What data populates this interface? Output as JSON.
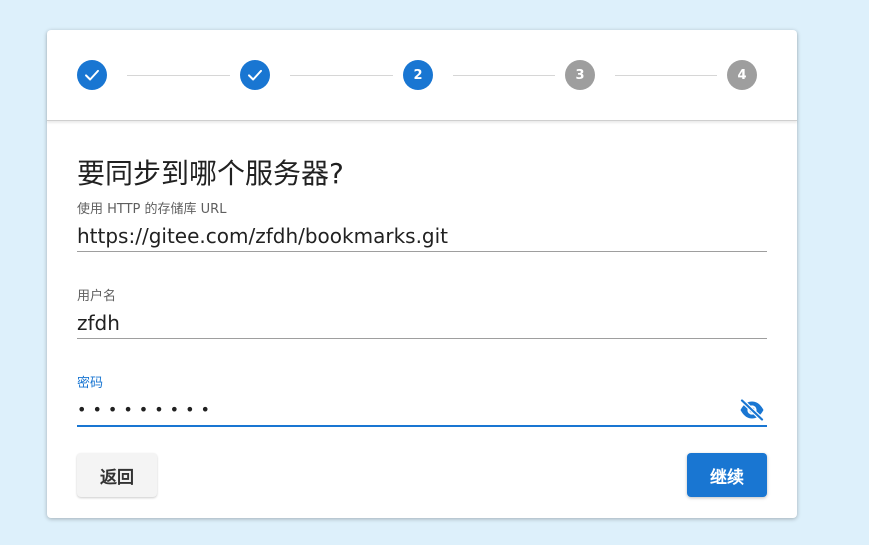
{
  "stepper": {
    "steps": [
      {
        "state": "done",
        "label": ""
      },
      {
        "state": "done",
        "label": ""
      },
      {
        "state": "active",
        "label": "2"
      },
      {
        "state": "todo",
        "label": "3"
      },
      {
        "state": "todo",
        "label": "4"
      }
    ]
  },
  "form": {
    "title": "要同步到哪个服务器?",
    "repo_label": "使用 HTTP 的存储库 URL",
    "repo_value": "https://gitee.com/zfdh/bookmarks.git",
    "user_label": "用户名",
    "user_value": "zfdh",
    "password_label": "密码",
    "password_mask": "•••••••••"
  },
  "actions": {
    "back_label": "返回",
    "continue_label": "继续"
  },
  "colors": {
    "primary": "#1976d2",
    "inactive_step": "#9e9e9e",
    "background": "#ddf0fb"
  },
  "icons": {
    "step_done": "check-icon",
    "password_toggle": "eye-off-icon"
  }
}
